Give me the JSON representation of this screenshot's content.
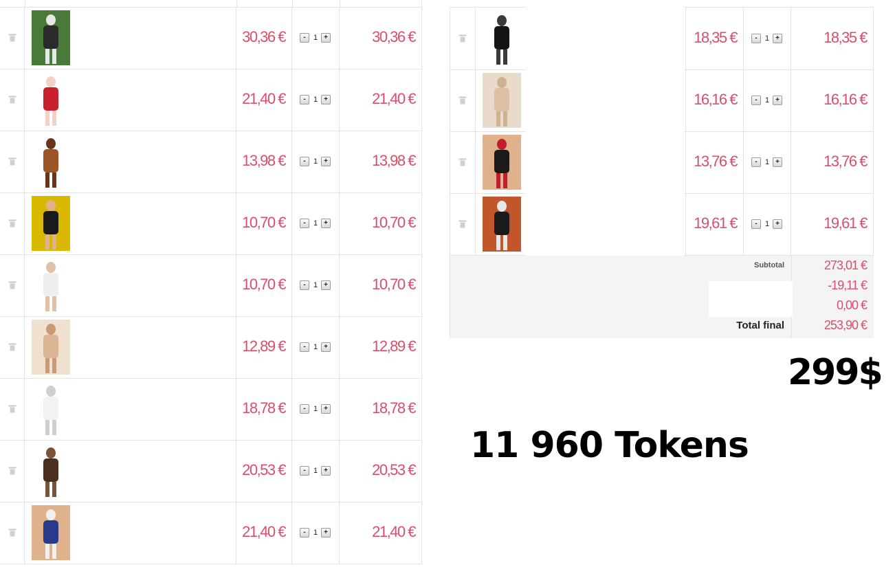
{
  "currency_color": "#d94f6b",
  "icons": {
    "delete": "trash-icon",
    "decrement": "minus-icon",
    "increment": "plus-icon"
  },
  "left_cart": {
    "items": [
      {
        "unit_price": "30,36 €",
        "qty": "1",
        "total": "30,36 €",
        "thumb_colors": [
          "#2a2a2a",
          "#e8e8e8",
          "#4a7a3a"
        ]
      },
      {
        "unit_price": "21,40 €",
        "qty": "1",
        "total": "21,40 €",
        "thumb_colors": [
          "#c8202e",
          "#f2d2c4",
          "#ffffff"
        ]
      },
      {
        "unit_price": "13,98 €",
        "qty": "1",
        "total": "13,98 €",
        "thumb_colors": [
          "#9a5426",
          "#6b3416",
          "#ffffff"
        ]
      },
      {
        "unit_price": "10,70 €",
        "qty": "1",
        "total": "10,70 €",
        "thumb_colors": [
          "#1a1a1a",
          "#e0b28c",
          "#d8b800"
        ]
      },
      {
        "unit_price": "10,70 €",
        "qty": "1",
        "total": "10,70 €",
        "thumb_colors": [
          "#eeeeee",
          "#e2c0a6",
          "#ffffff"
        ]
      },
      {
        "unit_price": "12,89 €",
        "qty": "1",
        "total": "12,89 €",
        "thumb_colors": [
          "#dcb594",
          "#c99a76",
          "#f0e0d0"
        ]
      },
      {
        "unit_price": "18,78 €",
        "qty": "1",
        "total": "18,78 €",
        "thumb_colors": [
          "#f2f2f2",
          "#cfcfcf",
          "#ffffff"
        ]
      },
      {
        "unit_price": "20,53 €",
        "qty": "1",
        "total": "20,53 €",
        "thumb_colors": [
          "#4a2e1e",
          "#7a5236",
          "#ffffff"
        ]
      },
      {
        "unit_price": "21,40 €",
        "qty": "1",
        "total": "21,40 €",
        "thumb_colors": [
          "#2a3a8a",
          "#f0f0f0",
          "#e0b28c"
        ]
      }
    ]
  },
  "right_cart": {
    "items": [
      {
        "unit_price": "18,35 €",
        "qty": "1",
        "total": "18,35 €",
        "thumb_colors": [
          "#151515",
          "#3a3a3a",
          "#ffffff"
        ]
      },
      {
        "unit_price": "16,16 €",
        "qty": "1",
        "total": "16,16 €",
        "thumb_colors": [
          "#dcbfa4",
          "#cfb08f",
          "#eadacb"
        ]
      },
      {
        "unit_price": "13,76 €",
        "qty": "1",
        "total": "13,76 €",
        "thumb_colors": [
          "#1a1a1a",
          "#c01e30",
          "#e0b28c"
        ]
      },
      {
        "unit_price": "19,61 €",
        "qty": "1",
        "total": "19,61 €",
        "thumb_colors": [
          "#1a1a1a",
          "#e8e8e8",
          "#c0562a"
        ]
      }
    ],
    "summary": {
      "subtotal_label": "Subtotal",
      "subtotal": "273,01 €",
      "discount": "-19,11 €",
      "shipping": "0,00 €",
      "total_label": "Total final",
      "total": "253,90 €"
    }
  },
  "overlay": {
    "price_usd": "299$",
    "tokens": "11 960 Tokens"
  }
}
